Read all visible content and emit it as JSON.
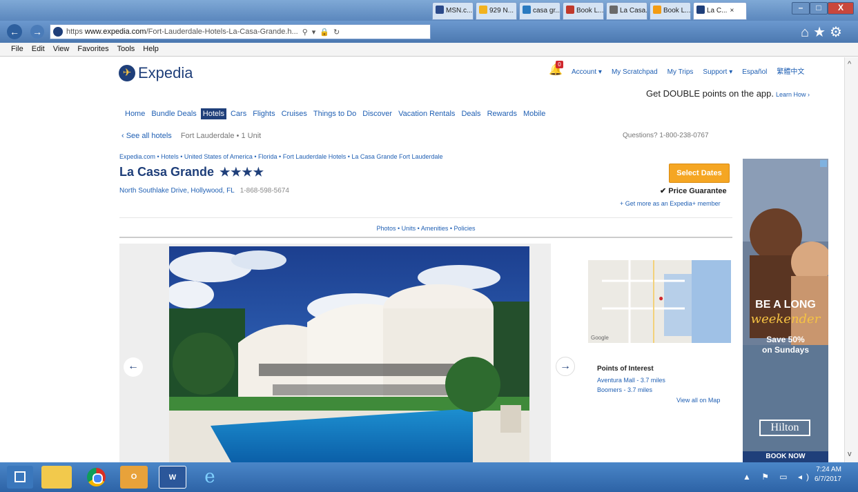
{
  "browser": {
    "address_prefix": "https",
    "address_domain": "www.expedia.com",
    "address_rest": "/Fort-Lauderdale-Hotels-La-Casa-Grande.h...",
    "tabs": [
      {
        "label": "MSN.c...",
        "color": "#2b4a8a"
      },
      {
        "label": "929 N...",
        "color": "#f2b21f"
      },
      {
        "label": "casa gr...",
        "color": "#2a7ac0"
      },
      {
        "label": "Book L...",
        "color": "#c0392b"
      },
      {
        "label": "La Casa...",
        "color": "#6a6a6a"
      },
      {
        "label": "Book L...",
        "color": "#f39c12"
      },
      {
        "label": "La C...",
        "color": "#1f3f7a"
      }
    ],
    "close_tab": "×",
    "window_buttons": {
      "minimize": "–",
      "maximize": "□",
      "close": "X"
    },
    "nav": {
      "back": "←",
      "forward": "→"
    },
    "address_controls": {
      "search": "⚲",
      "dropdown": "▾",
      "lock": "🔒",
      "refresh": "↻"
    },
    "tools": "⌂★⚙"
  },
  "menu": [
    "File",
    "Edit",
    "View",
    "Favorites",
    "Tools",
    "Help"
  ],
  "header": {
    "logo_globe": "✈",
    "logo": "Expedia",
    "bell": "🔔",
    "notification_count": "0",
    "topnav": [
      "Account ▾",
      "My Scratchpad",
      "My Trips",
      "Support ▾",
      "Español",
      "繁體中文"
    ],
    "app_promo": "Get DOUBLE points on the app.",
    "app_promo_link": "Learn How ›"
  },
  "mainnav": [
    "Home",
    "Bundle Deals",
    "Hotels",
    "Cars",
    "Flights",
    "Cruises",
    "Things to Do",
    "Discover",
    "Vacation Rentals",
    "Deals",
    "Rewards",
    "Mobile"
  ],
  "mainnav_active": "Hotels",
  "backbar": {
    "see_all": "‹ See all hotels",
    "search_summary": "Fort Lauderdale • 1 Unit",
    "questions": "Questions? 1-800-238-0767"
  },
  "breadcrumb": "Expedia.com • Hotels • United States of America • Florida • Fort Lauderdale Hotels • La Casa Grande Fort Lauderdale",
  "hotel": {
    "name": "La Casa Grande",
    "stars": "★★★★",
    "address": "North Southlake Drive, Hollywood, FL",
    "phone": "1-868-598-5674"
  },
  "booking": {
    "select_dates": "Select Dates",
    "price_guarantee": "✔ Price Guarantee",
    "expedia_plus": "+ Get more as an Expedia+ member"
  },
  "section_links": "Photos • Units • Amenities • Policies",
  "gallery": {
    "prev": "←",
    "next": "→"
  },
  "map": {
    "credit": "Google",
    "pin": "●"
  },
  "poi": {
    "title": "Points of Interest",
    "items": [
      "Aventura Mall - 3.7 miles",
      "Boomers - 3.7 miles"
    ],
    "view_all": "View all on Map"
  },
  "ad": {
    "headline": "BE A LONG",
    "script": "weekender",
    "offer_1": "Save 50%",
    "offer_2": "on Sundays",
    "brand": "Hilton",
    "cta": "BOOK NOW"
  },
  "scrollbar": {
    "up": "^",
    "down": "v"
  },
  "taskbar": {
    "outlook": "O",
    "word": "W",
    "ie": "e",
    "tray": "▲ ⚑ ▭ ◂)",
    "time": "7:24 AM",
    "date": "6/7/2017"
  }
}
